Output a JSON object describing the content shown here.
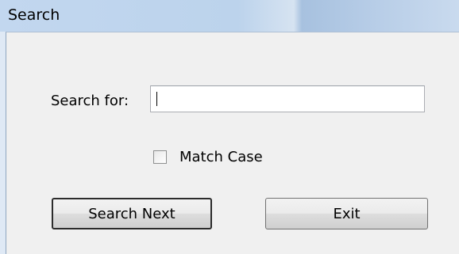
{
  "window": {
    "title": "Search"
  },
  "form": {
    "search_label": "Search for:",
    "search_value": "",
    "match_case_label": "Match Case",
    "match_case_checked": false
  },
  "buttons": {
    "search_next": "Search Next",
    "exit": "Exit"
  }
}
